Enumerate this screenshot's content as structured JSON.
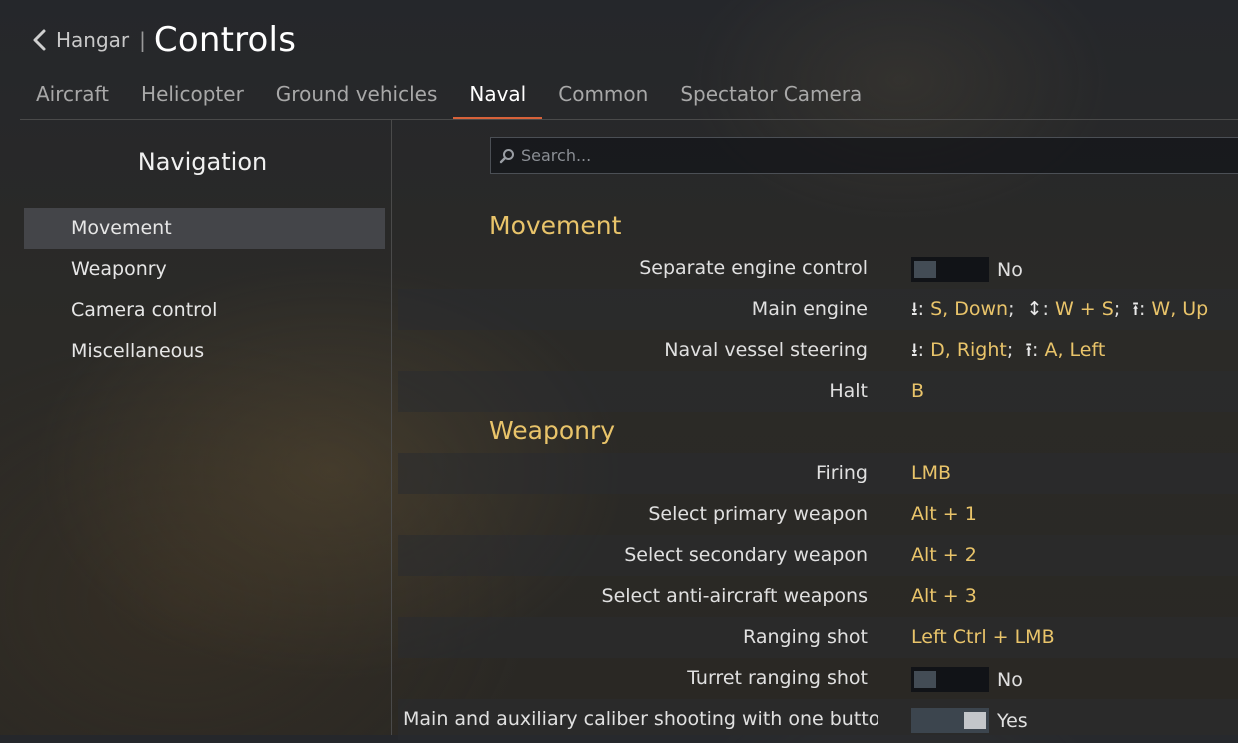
{
  "header": {
    "back_label": "Hangar",
    "separator": "|",
    "title": "Controls"
  },
  "tabs": [
    {
      "label": "Aircraft"
    },
    {
      "label": "Helicopter"
    },
    {
      "label": "Ground vehicles"
    },
    {
      "label": "Naval",
      "active": true
    },
    {
      "label": "Common"
    },
    {
      "label": "Spectator Camera"
    }
  ],
  "nav": {
    "title": "Navigation",
    "items": [
      {
        "label": "Movement",
        "active": true
      },
      {
        "label": "Weaponry"
      },
      {
        "label": "Camera control"
      },
      {
        "label": "Miscellaneous"
      }
    ]
  },
  "search": {
    "placeholder": "Search..."
  },
  "sections": {
    "movement": {
      "title": "Movement",
      "rows": {
        "separate_engine": {
          "label": "Separate engine control",
          "toggle_state": "No"
        },
        "main_engine": {
          "label": "Main engine",
          "down_keys": "S, Down",
          "axis_keys": "W + S",
          "up_keys": "W, Up"
        },
        "steering": {
          "label": "Naval vessel steering",
          "right_keys": "D, Right",
          "left_keys": "A, Left"
        },
        "halt": {
          "label": "Halt",
          "keys": "B"
        }
      }
    },
    "weaponry": {
      "title": "Weaponry",
      "rows": {
        "firing": {
          "label": "Firing",
          "keys": "LMB"
        },
        "primary": {
          "label": "Select primary weapon",
          "keys": "Alt + 1"
        },
        "secondary": {
          "label": "Select secondary weapon",
          "keys": "Alt + 2"
        },
        "anti_aircraft": {
          "label": "Select anti-aircraft weapons",
          "keys": "Alt + 3"
        },
        "ranging": {
          "label": "Ranging shot",
          "keys": "Left Ctrl + LMB"
        },
        "turret_ranging": {
          "label": "Turret ranging shot",
          "toggle_state": "No"
        },
        "one_button": {
          "label": "Main and auxiliary caliber shooting with one button",
          "toggle_state": "Yes"
        }
      }
    }
  },
  "colors": {
    "accent_value": "#e9c46a",
    "tab_underline": "#d8623a"
  }
}
